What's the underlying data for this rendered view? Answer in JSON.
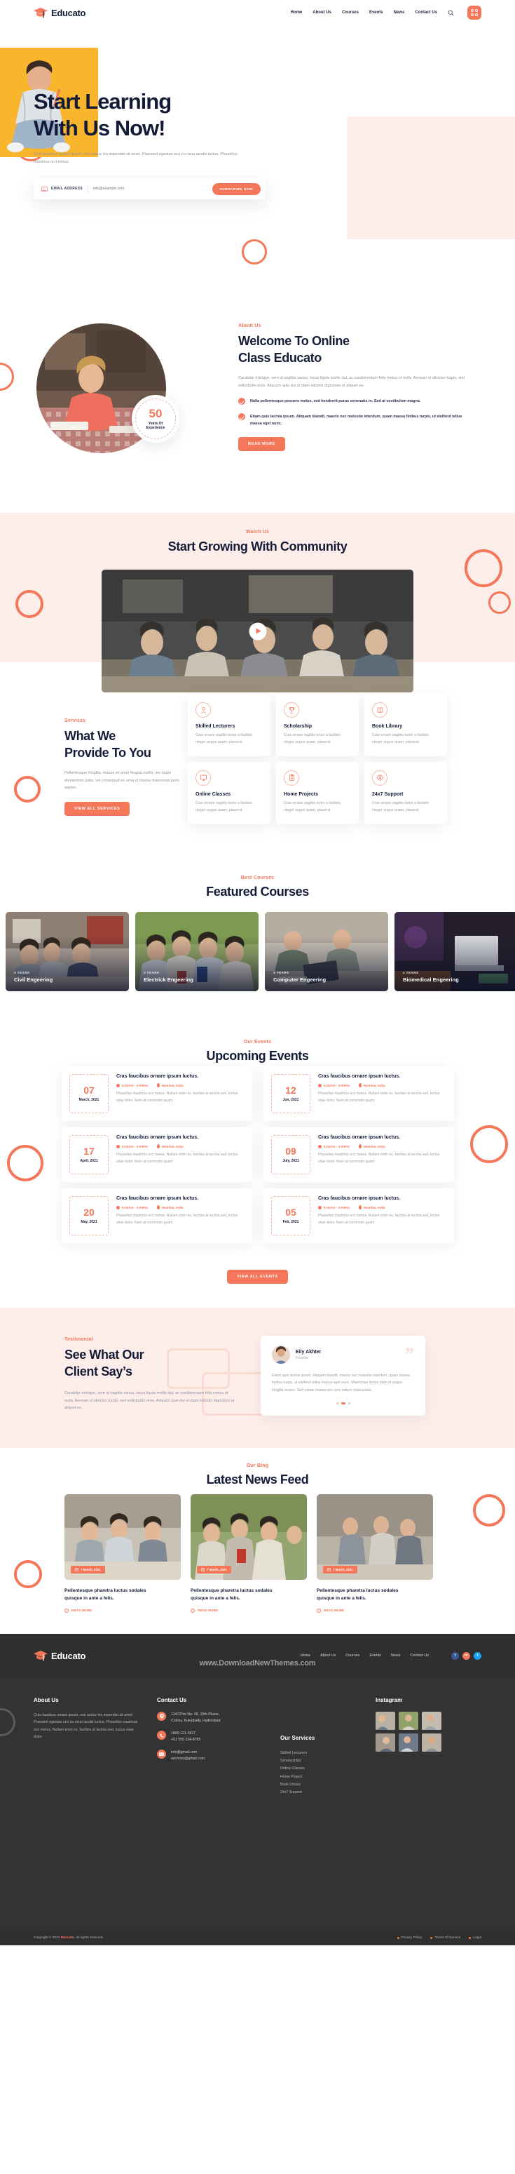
{
  "brand": {
    "name": "Educato"
  },
  "nav": {
    "items": [
      "Home",
      "About Us",
      "Courses",
      "Events",
      "News",
      "Contact Us"
    ],
    "search_icon": "search-icon",
    "menu_icon": "grid-menu-icon"
  },
  "hero": {
    "title_line1": "Start Learning",
    "title_line2": "With Us Now!",
    "paragraph": "Cras faucibus ornare ipsum, non luctus leo imperdiet sit amet. Praesent egestas orci eu risus iaculis luctus. Phasellus maximus orci metus.",
    "form": {
      "label": "EMAIL ADDRESS",
      "placeholder": "info@example.com",
      "button": "SUBSCRIBE NOW"
    }
  },
  "about": {
    "eyebrow": "About Us",
    "title_line1": "Welcome To Online",
    "title_line2": "Class Educato",
    "paragraph": "Curabitur tristique, sem id sagittis varius, lacus ligula mollis dui, ac condimentum felis metus ut nulla. Aenean ut ultricies turpis, sed sollicitudin eros. Aliquam quis dui ut diam lobortis dignissim ut aliquet ex.",
    "bullets": [
      "Nulla pellentesque posuere metus, sed hendrerit purus venenatis in. Sed at vestibulum magna.",
      "Etiam quis lacinia ipsum. Aliquam blandit, mauris nec molestie interdum, quam massa finibus turpis, ut eleifend tellus massa eget nunc."
    ],
    "button": "READ MORE",
    "badge": {
      "number": "50",
      "line1": "Years Of",
      "line2": "Experience"
    }
  },
  "video": {
    "eyebrow": "Watch Us",
    "title": "Start Growing With Community",
    "play_icon": "play-icon"
  },
  "services": {
    "eyebrow": "Services",
    "title_line1": "What We",
    "title_line2": "Provide To You",
    "paragraph": "Pellentesque fringilla, massa sit amet feugiat mollis, leo turpis elementum justo, vel consequat ex urna ut massa maecenas justo sapien.",
    "button": "VIEW ALL SERVICES",
    "cards": [
      {
        "icon": "lecturer-icon",
        "title": "Skilled Lecturers",
        "text": "Cras ornare sagittis tortor a facilisis nteger augue quam, placerat."
      },
      {
        "icon": "trophy-icon",
        "title": "Scholarship",
        "text": "Cras ornare sagittis tortor a facilisis nteger augue quam, placerat."
      },
      {
        "icon": "book-icon",
        "title": "Book Library",
        "text": "Cras ornare sagittis tortor a facilisis nteger augue quam, placerat."
      },
      {
        "icon": "monitor-icon",
        "title": "Online Classes",
        "text": "Cras ornare sagittis tortor a facilisis nteger augue quam, placerat."
      },
      {
        "icon": "clipboard-icon",
        "title": "Home Projects",
        "text": "Cras ornare sagittis tortor a facilisis nteger augue quam, placerat."
      },
      {
        "icon": "support-icon",
        "title": "24x7 Support",
        "text": "Cras ornare sagittis tortor a facilisis nteger augue quam, placerat."
      }
    ]
  },
  "courses": {
    "eyebrow": "Best Courses",
    "title": "Featured Courses",
    "items": [
      {
        "years": "3 YEARS",
        "title": "Civil Engeering"
      },
      {
        "years": "2 YEARS",
        "title": "Electrick Engeering"
      },
      {
        "years": "3 YEARS",
        "title": "Computer Engeering"
      },
      {
        "years": "4 YEARS",
        "title": "Biomedical Engeering"
      }
    ]
  },
  "events": {
    "eyebrow": "Our Events",
    "title": "Upcoming Events",
    "button": "VIEW ALL EVENTS",
    "items": [
      {
        "day": "07",
        "month": "March, 2021",
        "title": "Cras faucibus ornare ipsum luctus.",
        "time": "9:00Am - 3:00Pm",
        "location": "Mumbai, India",
        "text": "Phasellus maximus orci metus. Nullam enim ex, facilisis at lacinia sed, luctus vitae dolor. Nam at commodo quam."
      },
      {
        "day": "12",
        "month": "Jun, 2021",
        "title": "Cras faucibus ornare ipsum luctus.",
        "time": "9:00Am - 3:00Pm",
        "location": "Mumbai, India",
        "text": "Phasellus maximus orci metus. Nullam enim ex, facilisis at lacinia sed, luctus vitae dolor. Nam at commodo quam."
      },
      {
        "day": "17",
        "month": "April, 2021",
        "title": "Cras faucibus ornare ipsum luctus.",
        "time": "9:00Am - 3:00Pm",
        "location": "Mumbai, India",
        "text": "Phasellus maximus orci metus. Nullam enim ex, facilisis at lacinia sed, luctus vitae dolor. Nam at commodo quam."
      },
      {
        "day": "09",
        "month": "July, 2021",
        "title": "Cras faucibus ornare ipsum luctus.",
        "time": "9:00Am - 3:00Pm",
        "location": "Mumbai, India",
        "text": "Phasellus maximus orci metus. Nullam enim ex, facilisis at lacinia sed, luctus vitae dolor. Nam at commodo quam."
      },
      {
        "day": "20",
        "month": "May, 2021",
        "title": "Cras faucibus ornare ipsum luctus.",
        "time": "9:00Am - 3:00Pm",
        "location": "Mumbai, India",
        "text": "Phasellus maximus orci metus. Nullam enim ex, facilisis at lacinia sed, luctus vitae dolor. Nam at commodo quam."
      },
      {
        "day": "05",
        "month": "Feb, 2021",
        "title": "Cras faucibus ornare ipsum luctus.",
        "time": "9:00Am - 3:00Pm",
        "location": "Mumbai, India",
        "text": "Phasellus maximus orci metus. Nullam enim ex, facilisis at lacinia sed, luctus vitae dolor. Nam at commodo quam."
      }
    ]
  },
  "testimonial": {
    "eyebrow": "Testimonial",
    "title_line1": "See What Our",
    "title_line2": "Client Say’s",
    "paragraph": "Curabitur tristique, sem id sagittis varius, lacus ligula mollis dui, ac condimentum felis metus ut nulla. Aenean ut ultricies turpis, sed sollicitudin eros. Aliquam quis dui ut diam lobortis dignissim ut aliquet ex.",
    "card": {
      "name": "Eily Akhter",
      "role": "Founder",
      "quote_mark": "”",
      "text": "Etiam quis lacinia ipsum. Aliquam blandit, mauris nec molestie interdum, quam massa finibus turpis, ut eleifend tellus massa eget nunc. Maecenas lectus diam id augue fringilla ornare. Sed varius massa non sem rutrum malesuada."
    }
  },
  "blog": {
    "eyebrow": "Our Blog",
    "title": "Latest News Feed",
    "posts": [
      {
        "date": "7 March, 2021",
        "title_line1": "Pellentesque pharetra luctus sodales",
        "title_line2": "quisque in ante a felis.",
        "read_more": "READ MORE"
      },
      {
        "date": "7 March, 2021",
        "title_line1": "Pellentesque pharetra luctus sodales",
        "title_line2": "quisque in ante a felis.",
        "read_more": "READ MORE"
      },
      {
        "date": "7 March, 2021",
        "title_line1": "Pellentesque pharetra luctus sodales",
        "title_line2": "quisque in ante a felis.",
        "read_more": "READ MORE"
      }
    ]
  },
  "footer": {
    "nav": [
      "Home",
      "About Us",
      "Courses",
      "Events",
      "News",
      "Contact Us"
    ],
    "socials": [
      "f",
      "in",
      "t"
    ],
    "watermark": "www.DownloadNewThemes.com",
    "about": {
      "heading": "About Us",
      "text": "Cras faucibus ornare ipsum, non luctus leo imperdiet sit amet. Praesent egestas orci eu risus iaculis luctus. Phasellus maximus orci metus. Nullam enim ex, facilisis at lacinia sed, luctus vitae dolor."
    },
    "contact": {
      "heading": "Contact Us",
      "rows": [
        {
          "icon": "location-icon",
          "line1": "1247/Plot No. 39, 15th Phase,",
          "line2": "Colony, Kukatpally, Hyderabad"
        },
        {
          "icon": "phone-icon",
          "line1": "1800-121-3637",
          "line2": "+91 555 234-8765"
        },
        {
          "icon": "mail-icon",
          "line1": "info@gmail.com",
          "line2": "services@gmail.com"
        }
      ]
    },
    "services": {
      "heading": "Our Services",
      "items": [
        "Skilled Lecturers",
        "Scholarships",
        "Online Classes",
        "Home Project",
        "Book Library",
        "24x7 Support"
      ]
    },
    "instagram": {
      "heading": "Instagram"
    },
    "copyright_prefix": "Copyright © 2021 ",
    "copyright_brand": "Educato",
    "copyright_suffix": ". All rights reserved.",
    "bottom_links": [
      "Privacy Policy",
      "Terms Of Service",
      "Legal"
    ]
  }
}
